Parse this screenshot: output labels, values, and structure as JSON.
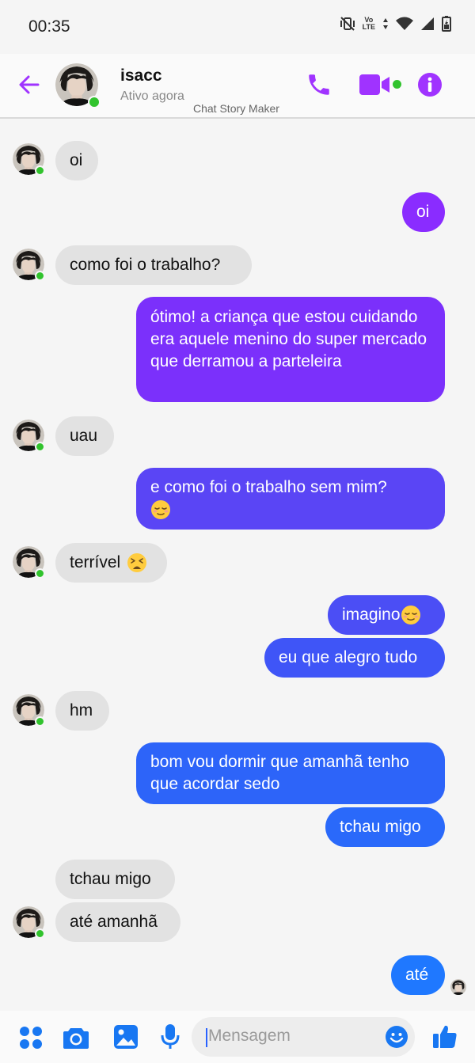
{
  "status_bar": {
    "time": "00:35",
    "network_label": "LTE"
  },
  "header": {
    "contact_name": "isacc",
    "contact_status": "Ativo agora",
    "watermark": "Chat Story Maker"
  },
  "messages": [
    {
      "side": "in",
      "text": "oi"
    },
    {
      "side": "out",
      "text": "oi"
    },
    {
      "side": "in",
      "text": "como foi o trabalho?"
    },
    {
      "side": "out",
      "text": "ótimo! a criança que estou cuidando era aquele menino do super mercado que derramou a parteleira"
    },
    {
      "side": "in",
      "text": "uau"
    },
    {
      "side": "out",
      "text": "e como foi o trabalho sem mim?",
      "emoji": "relieved-face"
    },
    {
      "side": "in",
      "text": "terrível",
      "emoji": "tired-face"
    },
    {
      "side": "out",
      "text": "imagino",
      "emoji": "relieved-face"
    },
    {
      "side": "out",
      "text": "eu que alegro tudo"
    },
    {
      "side": "in",
      "text": "hm"
    },
    {
      "side": "out",
      "text": "bom vou dormir que amanhã tenho que acordar sedo"
    },
    {
      "side": "out",
      "text": "tchau migo"
    },
    {
      "side": "in",
      "text": "tchau migo"
    },
    {
      "side": "in",
      "text": "até amanhã"
    },
    {
      "side": "out",
      "text": "até"
    }
  ],
  "composer": {
    "placeholder": "Mensagem"
  },
  "colors": {
    "accent": "#a033ff",
    "gradient_top": "#8a2cff",
    "gradient_bottom": "#1f78ff",
    "incoming_bubble": "#e2e2e2",
    "online": "#31c32d",
    "toolbar_icons": "#1877f2"
  },
  "icons": {
    "back": "arrow-left-icon",
    "phone": "phone-icon",
    "video": "video-camera-icon",
    "info": "info-icon",
    "apps": "four-dots-icon",
    "camera": "camera-icon",
    "gallery": "image-icon",
    "mic": "microphone-icon",
    "emoji": "smiley-icon",
    "like": "thumbs-up-icon"
  }
}
